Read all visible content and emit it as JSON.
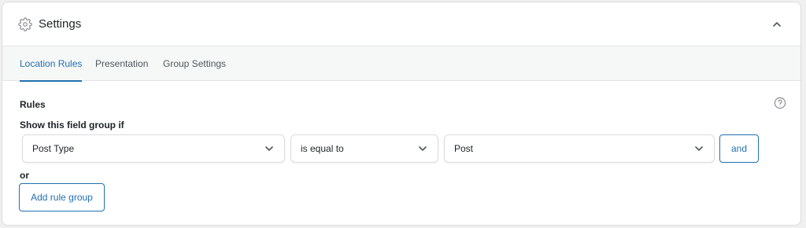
{
  "panel": {
    "title": "Settings",
    "icon": "gear-icon",
    "collapse_icon": "chevron-up-icon"
  },
  "tabs": [
    {
      "label": "Location Rules",
      "active": true
    },
    {
      "label": "Presentation",
      "active": false
    },
    {
      "label": "Group Settings",
      "active": false
    }
  ],
  "rules": {
    "heading": "Rules",
    "help_icon": "question-circle-icon",
    "condition_label": "Show this field group if",
    "rule": {
      "param": "Post Type",
      "operator": "is equal to",
      "value": "Post"
    },
    "and_label": "and",
    "or_label": "or",
    "add_group_label": "Add rule group"
  },
  "colors": {
    "accent": "#2271b1",
    "text": "#1d2327",
    "muted": "#50575e",
    "border": "#dcdcde",
    "tab_bar_bg": "#f6f7f7",
    "page_bg": "#f0f0f1"
  }
}
